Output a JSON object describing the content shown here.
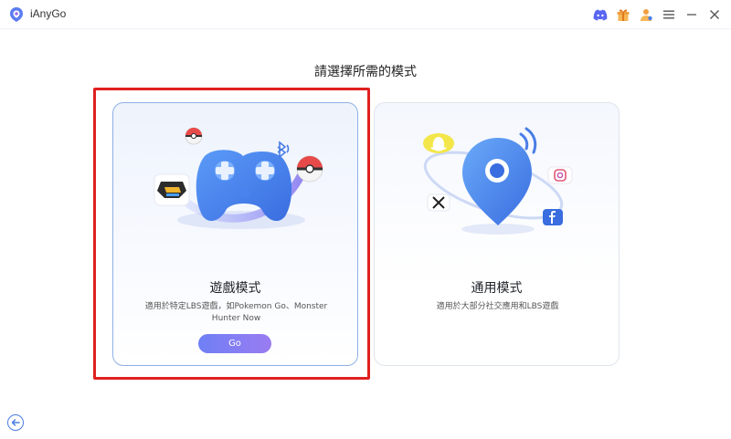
{
  "app": {
    "title": "iAnyGo",
    "icons": [
      "discord-icon",
      "gift-icon",
      "account-icon",
      "menu-icon",
      "minimize-icon",
      "close-icon"
    ]
  },
  "main": {
    "heading": "請選擇所需的模式",
    "cards": [
      {
        "id": "game-mode",
        "title": "遊戲模式",
        "description": "適用於特定LBS遊戲，如Pokemon Go、Monster Hunter Now",
        "button_label": "Go",
        "selected": true
      },
      {
        "id": "general-mode",
        "title": "通用模式",
        "description": "適用於大部分社交應用和LBS遊戲",
        "selected": false
      }
    ]
  },
  "colors": {
    "accent": "#4a7de6",
    "button_gradient_start": "#6f7ff5",
    "button_gradient_end": "#9a7cf2",
    "highlight": "#e02020"
  }
}
